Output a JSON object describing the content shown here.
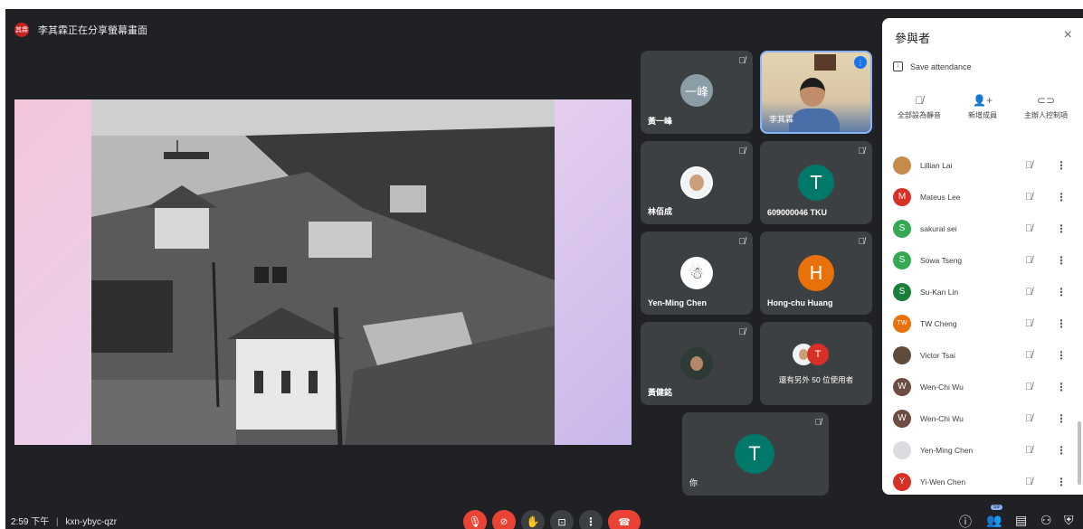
{
  "presenting_banner": "李其霖正在分享螢幕畫面",
  "presenter_initials": "其霖",
  "tiles": [
    {
      "name": "黃一峰",
      "avatar_text": "一峰"
    },
    {
      "name": "李其霖"
    },
    {
      "name": "林佰成"
    },
    {
      "name": "609000046 TKU",
      "avatar_text": "T"
    },
    {
      "name": "Yen-Ming Chen"
    },
    {
      "name": "Hong-chu Huang",
      "avatar_text": "H"
    },
    {
      "name": "黃健銘"
    },
    {
      "name": "還有另外 50 位使用者",
      "avatar_text": "T"
    },
    {
      "name": "你",
      "avatar_text": "T"
    }
  ],
  "panel": {
    "title": "參與者",
    "close": "×",
    "save_attendance": "Save attendance",
    "actions": [
      "全部設為靜音",
      "新增成員",
      "主辦人控制項"
    ]
  },
  "participants": [
    {
      "name": "Lillian Lai",
      "avatar": "",
      "color": "#c58b4b"
    },
    {
      "name": "Mateus Lee",
      "avatar": "M",
      "color": "#d93025"
    },
    {
      "name": "sakurai sei",
      "avatar": "S",
      "color": "#34a853"
    },
    {
      "name": "Sowa Tseng",
      "avatar": "S",
      "color": "#34a853"
    },
    {
      "name": "Su-Kan Lin",
      "avatar": "S",
      "color": "#188038"
    },
    {
      "name": "TW Cheng",
      "avatar": "TW",
      "color": "#e8710a"
    },
    {
      "name": "Victor Tsai",
      "avatar": "",
      "color": "#5f4b3a"
    },
    {
      "name": "Wen-Chi Wu",
      "avatar": "W",
      "color": "#6d4c41"
    },
    {
      "name": "Wen-Chi Wu",
      "avatar": "W",
      "color": "#6d4c41"
    },
    {
      "name": "Yen-Ming Chen",
      "avatar": "",
      "color": "#dadce0"
    },
    {
      "name": "Yi-Wen Chen",
      "avatar": "Y",
      "color": "#d93025"
    }
  ],
  "bottom": {
    "time": "2:59 下午",
    "separator": "|",
    "meeting_code": "kxn-ybyc-qzr",
    "people_count": "59"
  },
  "colors": {
    "background": "#202124",
    "tile": "#3c4043",
    "teal": "#00796b",
    "orange": "#e8710a",
    "red": "#ea4335"
  }
}
